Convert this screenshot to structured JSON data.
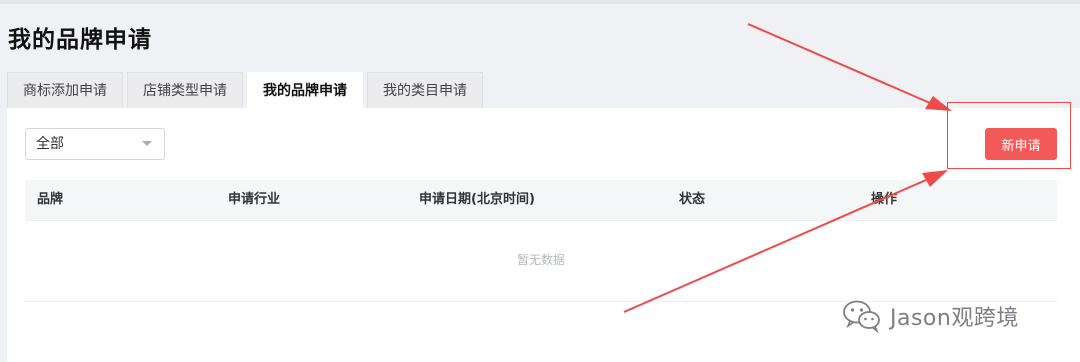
{
  "page": {
    "title": "我的品牌申请"
  },
  "tabs": [
    {
      "label": "商标添加申请",
      "active": false
    },
    {
      "label": "店铺类型申请",
      "active": false
    },
    {
      "label": "我的品牌申请",
      "active": true
    },
    {
      "label": "我的类目申请",
      "active": false
    }
  ],
  "filter": {
    "selected": "全部"
  },
  "actions": {
    "new_label": "新申请"
  },
  "table": {
    "columns": [
      "品牌",
      "申请行业",
      "申请日期(北京时间)",
      "状态",
      "操作"
    ],
    "empty_text": "暂无数据"
  },
  "watermark": {
    "text": "Jason观跨境",
    "icon": "wechat-logo"
  },
  "colors": {
    "accent": "#f25a5a",
    "annotation": "#ef4a4a",
    "page_bg": "#f0f1f4"
  }
}
